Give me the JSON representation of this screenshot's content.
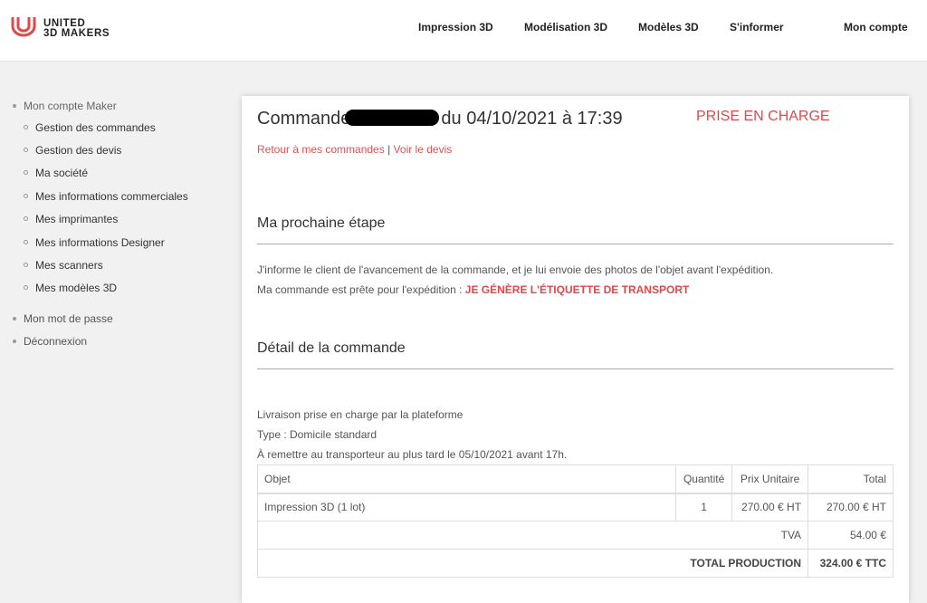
{
  "brand": {
    "line1": "UNITED",
    "line2": "3D MAKERS",
    "accent": "#e0484b"
  },
  "nav": {
    "items": [
      {
        "label": "Impression 3D"
      },
      {
        "label": "Modélisation 3D"
      },
      {
        "label": "Modèles 3D"
      },
      {
        "label": "S'informer"
      },
      {
        "label": "Mon compte"
      }
    ]
  },
  "sidebar": {
    "section": "Mon compte Maker",
    "items": [
      {
        "label": "Gestion des commandes"
      },
      {
        "label": "Gestion des devis"
      },
      {
        "label": "Ma société"
      },
      {
        "label": "Mes informations commerciales"
      },
      {
        "label": "Mes imprimantes"
      },
      {
        "label": "Mes informations Designer"
      },
      {
        "label": "Mes scanners"
      },
      {
        "label": "Mes modèles 3D"
      }
    ],
    "password": "Mon mot de passe",
    "logout": "Déconnexion"
  },
  "order": {
    "title_prefix": "Commande",
    "title_suffix": "du 04/10/2021 à 17:39",
    "status": "PRISE EN CHARGE",
    "back_link": "Retour à mes commandes",
    "separator": "|",
    "quote_link": "Voir le devis"
  },
  "next_step": {
    "title": "Ma prochaine étape",
    "line1": "J'informe le client de l'avancement de la commande, et je lui envoie des photos de l'objet avant l'expédition.",
    "line2_prefix": "Ma commande est prête pour l'expédition :",
    "line2_cta": "JE GÉNÈRE L'ÉTIQUETTE DE TRANSPORT"
  },
  "details": {
    "title": "Détail de la commande",
    "delivery": "Livraison prise en charge par la plateforme",
    "type": "Type : Domicile standard",
    "deadline": "À remettre au transporteur au plus tard le 05/10/2021 avant 17h."
  },
  "table": {
    "headers": {
      "object": "Objet",
      "quantity": "Quantité",
      "unit_price": "Prix Unitaire",
      "total": "Total"
    },
    "rows": [
      {
        "object": "Impression 3D (1 lot)",
        "quantity": "1",
        "unit_price": "270.00 € HT",
        "total": "270.00 € HT"
      }
    ],
    "vat_label": "TVA",
    "vat_value": "54.00 €",
    "total_label": "TOTAL PRODUCTION",
    "total_value": "324.00 € TTC"
  }
}
